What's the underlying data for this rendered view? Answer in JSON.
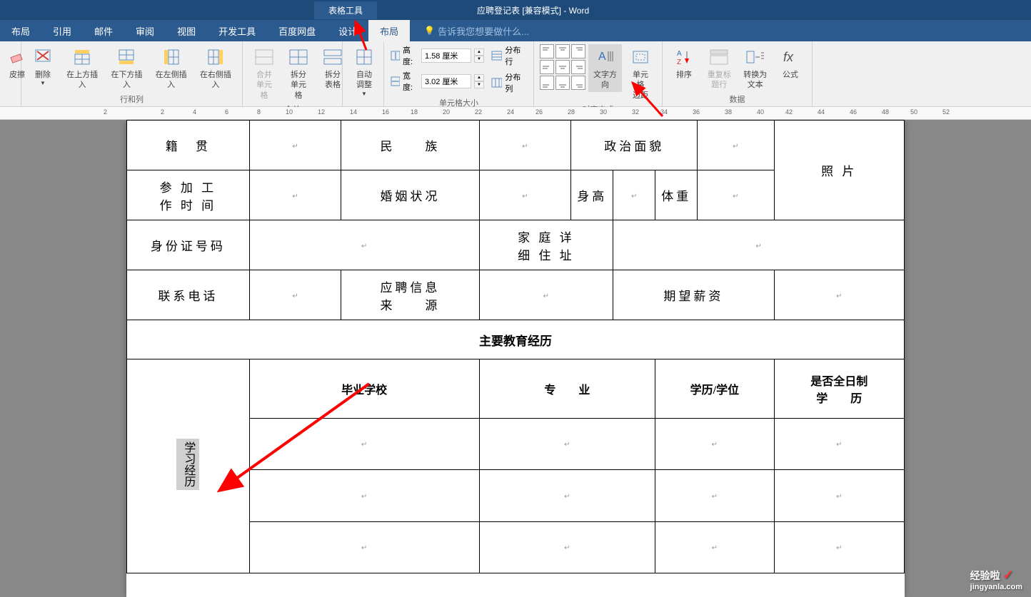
{
  "titlebar": {
    "tools_label": "表格工具",
    "doc_title": "应聘登记表 [兼容模式] - Word"
  },
  "menu": {
    "items": [
      "布局",
      "引用",
      "邮件",
      "审阅",
      "视图",
      "开发工具",
      "百度网盘",
      "设计",
      "布局"
    ],
    "tell_me": "告诉我您想要做什么..."
  },
  "ribbon": {
    "groups": {
      "draw": {
        "erase": "皮擦"
      },
      "rowcol": {
        "label": "行和列",
        "delete": "删除",
        "insert_above": "在上方插入",
        "insert_below": "在下方插入",
        "insert_left": "在左侧插入",
        "insert_right": "在右侧插入"
      },
      "merge": {
        "label": "合并",
        "merge_cells": "合并\n单元格",
        "split_cells": "拆分\n单元格",
        "split_table": "拆分表格"
      },
      "autofit": {
        "label": "自动调整"
      },
      "cellsize": {
        "label": "单元格大小",
        "height": "高度:",
        "width": "宽度:",
        "height_val": "1.58 厘米",
        "width_val": "3.02 厘米",
        "dist_rows": "分布行",
        "dist_cols": "分布列"
      },
      "alignment": {
        "label": "对齐方式",
        "text_direction": "文字方向",
        "cell_margins": "单元格\n边距"
      },
      "data": {
        "label": "数据",
        "sort": "排序",
        "repeat_header": "重复标题行",
        "convert": "转换为文本",
        "formula": "公式"
      }
    }
  },
  "ruler_marks": [
    "2",
    "2",
    "4",
    "6",
    "8",
    "10",
    "12",
    "14",
    "16",
    "18",
    "20",
    "22",
    "24",
    "26",
    "28",
    "30",
    "32",
    "34",
    "36",
    "38",
    "40",
    "42",
    "44",
    "46",
    "48",
    "50",
    "52"
  ],
  "form": {
    "row1": {
      "c1": "籍　贯",
      "c2": "民　　族",
      "c3": "政治面貌"
    },
    "row2": {
      "c1": "参 加 工\n作 时 间",
      "c2": "婚姻状况",
      "c3": "身高",
      "c4": "体重"
    },
    "photo": "照 片",
    "row3": {
      "c1": "身份证号码",
      "c2": "家 庭 详\n细 住 址"
    },
    "row4": {
      "c1": "联系电话",
      "c2": "应聘信息\n来　　源",
      "c3": "期望薪资"
    },
    "row5": "主要教育经历",
    "row6": {
      "c1": "学习经历",
      "c2": "毕业学校",
      "c3": "专　　业",
      "c4": "学历/学位",
      "c5": "是否全日制\n学　　历"
    }
  },
  "watermark": {
    "brand": "经验啦",
    "url": "jingyanla.com"
  }
}
